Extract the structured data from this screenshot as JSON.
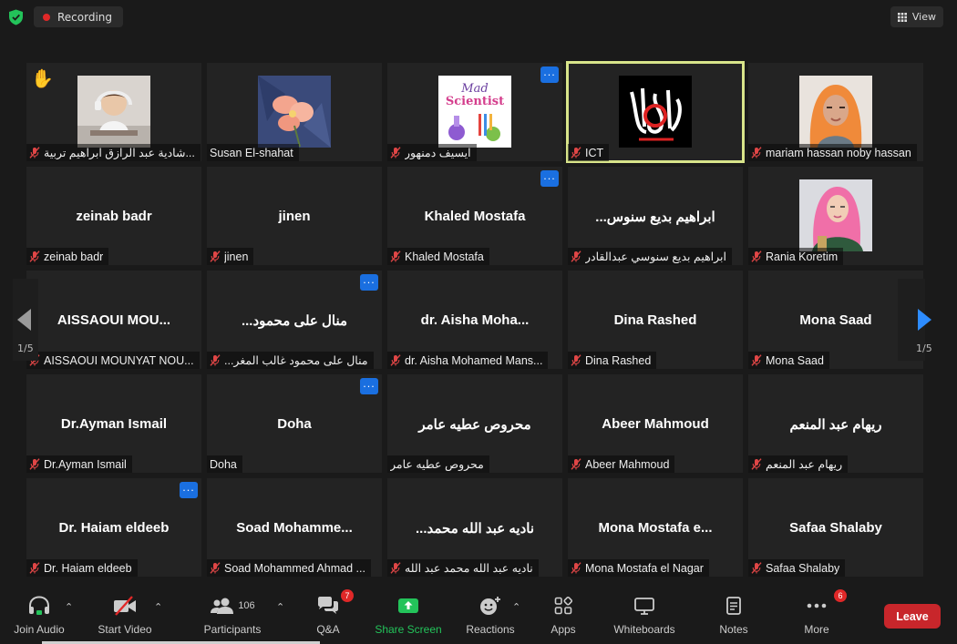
{
  "topbar": {
    "recording_label": "Recording",
    "view_label": "View"
  },
  "tiles": [
    {
      "label": "شادية عبد الرازق ابراهيم تربية...",
      "video": "girl-with-headphones",
      "hand": true,
      "muted": true
    },
    {
      "label": "Susan El-shahat",
      "video": "flowers",
      "muted": false
    },
    {
      "label": "ايسيف دمنهور",
      "video": "mad-scientist",
      "more": true,
      "muted": true
    },
    {
      "label": "ICT",
      "video": "calligraphy",
      "active": true,
      "muted": true
    },
    {
      "label": "mariam hassan noby hassan",
      "video": "woman-orange-hijab",
      "muted": true
    },
    {
      "big": "zeinab badr",
      "label": "zeinab badr",
      "muted": true
    },
    {
      "big": "jinen",
      "label": "jinen",
      "muted": true
    },
    {
      "big": "Khaled Mostafa",
      "label": "Khaled Mostafa",
      "more": true,
      "muted": true
    },
    {
      "big": "...ابراهيم بديع سنوس",
      "label": "ابراهيم بديع سنوسي عبدالقادر",
      "muted": true
    },
    {
      "label": "Rania Koretim",
      "video": "woman-pink-hijab",
      "muted": true
    },
    {
      "big": "AISSAOUI  MOU...",
      "label": "AISSAOUI MOUNYAT NOU...",
      "muted": true
    },
    {
      "big": "...منال على محمود",
      "label": "...منال على محمود غالب المغر",
      "more": true,
      "muted": true
    },
    {
      "big": "dr. Aisha Moha...",
      "label": "dr. Aisha Mohamed Mans...",
      "muted": true
    },
    {
      "big": "Dina Rashed",
      "label": "Dina Rashed",
      "muted": true
    },
    {
      "big": "Mona Saad",
      "label": "Mona Saad",
      "muted": true
    },
    {
      "big": "Dr.Ayman Ismail",
      "label": "Dr.Ayman Ismail",
      "muted": true
    },
    {
      "big": "Doha",
      "label": "Doha",
      "more": true,
      "muted": false
    },
    {
      "big": "محروص عطيه عامر",
      "label": "محروص عطيه عامر",
      "muted": false
    },
    {
      "big": "Abeer Mahmoud",
      "label": "Abeer Mahmoud",
      "muted": true
    },
    {
      "big": "ريهام عبد المنعم",
      "label": "ريهام عبد المنعم",
      "muted": true
    },
    {
      "big": "Dr. Haiam eldeeb",
      "label": "Dr. Haiam eldeeb",
      "more": true,
      "muted": true
    },
    {
      "big": "Soad  Mohamme...",
      "label": "Soad Mohammed Ahmad ...",
      "muted": true
    },
    {
      "big": "...ناديه عبد الله محمد",
      "label": "ناديه عبد الله محمد عبد الله",
      "muted": true
    },
    {
      "big": "Mona  Mostafa  e...",
      "label": "Mona Mostafa el Nagar",
      "muted": true
    },
    {
      "big": "Safaa Shalaby",
      "label": "Safaa Shalaby",
      "muted": true
    }
  ],
  "pagination": {
    "left": "1/5",
    "right": "1/5"
  },
  "toolbar": {
    "join_audio": "Join Audio",
    "start_video": "Start Video",
    "participants": "Participants",
    "participants_count": "106",
    "qa": "Q&A",
    "qa_badge": "7",
    "share_screen": "Share Screen",
    "reactions": "Reactions",
    "apps": "Apps",
    "whiteboards": "Whiteboards",
    "notes": "Notes",
    "more": "More",
    "more_badge": "6",
    "leave": "Leave"
  },
  "colors": {
    "background": "#1a1a1a",
    "tile": "#232323",
    "active_border": "#d8e48a",
    "share_green": "#23c35a",
    "leave_red": "#c8262b",
    "accent_blue": "#1a6fe0",
    "recording_red": "#e02828"
  }
}
